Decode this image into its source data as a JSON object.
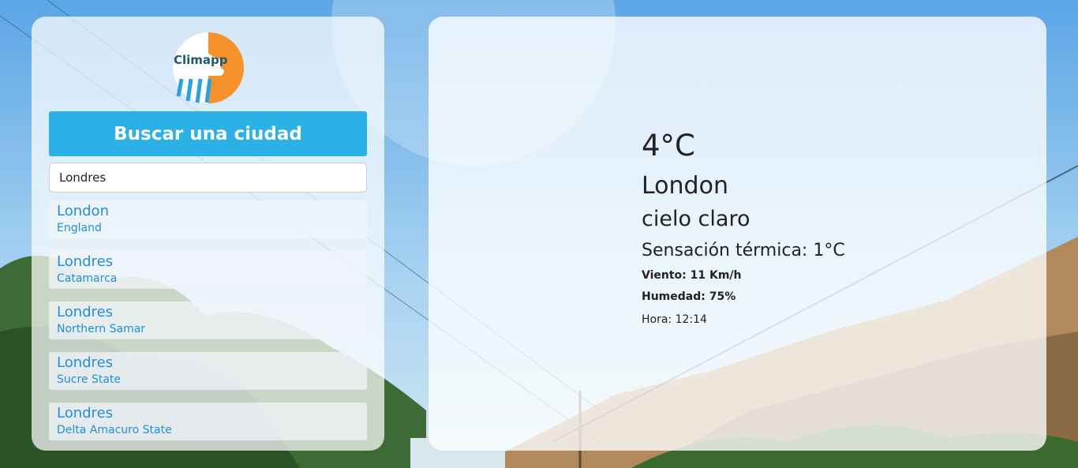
{
  "app": {
    "logo_text": "Climapp"
  },
  "search": {
    "button_label": "Buscar una ciudad",
    "input_value": "Londres"
  },
  "results": [
    {
      "name": "London",
      "region": "England"
    },
    {
      "name": "Londres",
      "region": "Catamarca"
    },
    {
      "name": "Londres",
      "region": "Northern Samar"
    },
    {
      "name": "Londres",
      "region": "Sucre State"
    },
    {
      "name": "Londres",
      "region": "Delta Amacuro State"
    }
  ],
  "weather": {
    "temperature": "4°C",
    "city": "London",
    "description": "cielo claro",
    "feels_like": "Sensación térmica: 1°C",
    "wind": "Viento: 11 Km/h",
    "humidity": "Humedad: 75%",
    "time": "Hora: 12:14"
  },
  "colors": {
    "accent": "#2bb1e6",
    "link": "#1f8fe0",
    "logo_orange": "#f7922a",
    "logo_blue": "#29a3e0"
  },
  "icons": {
    "logo": "rain-cloud-logo-icon"
  }
}
